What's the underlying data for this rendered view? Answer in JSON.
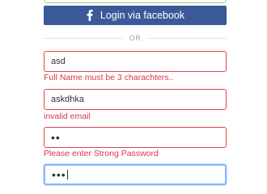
{
  "login": {
    "facebook_label": "Login via facebook",
    "divider_text": "OR"
  },
  "form": {
    "full_name": {
      "value": "asd",
      "error": "Full Name must be 3 charachters.."
    },
    "email": {
      "value": "askdhka",
      "error": "invalid email"
    },
    "password": {
      "value": "••",
      "error": "Please enter Strong Password"
    },
    "confirm_password": {
      "value": "•••"
    }
  },
  "colors": {
    "facebook": "#3b5998",
    "error": "#dc3545",
    "focus": "#86b7fe"
  }
}
